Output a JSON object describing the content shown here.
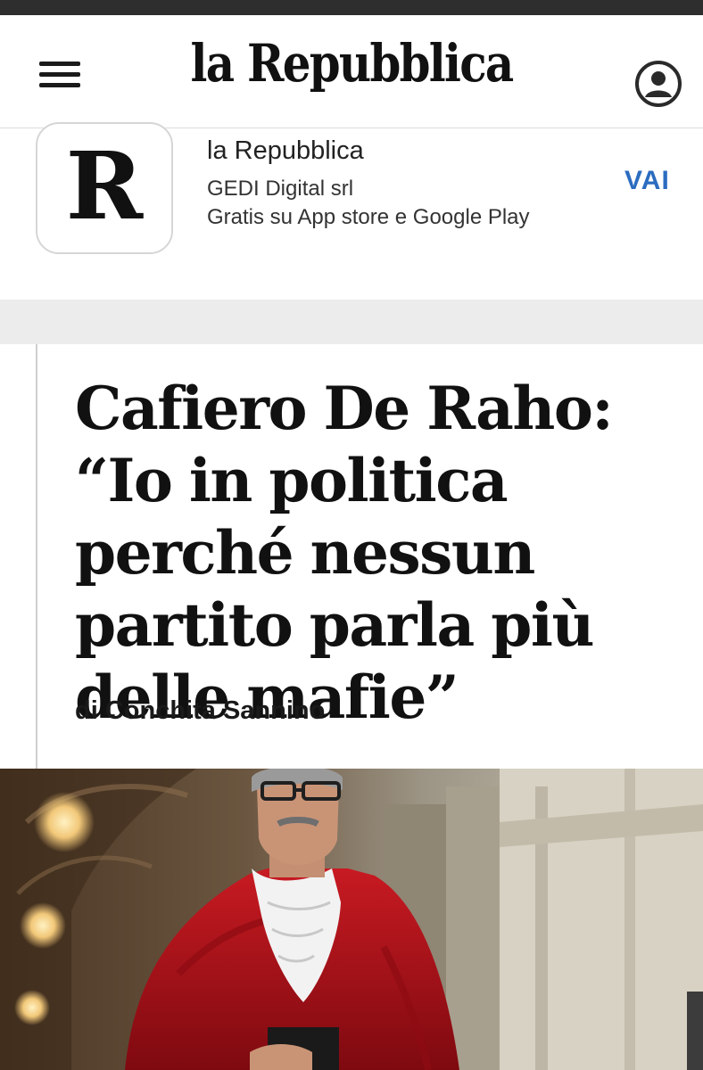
{
  "header": {
    "logo_text": "la Repubblica",
    "menu_icon": "hamburger-menu-icon",
    "account_icon": "user-account-icon"
  },
  "app_banner": {
    "icon_letter": "R",
    "app_name": "la Repubblica",
    "publisher": "GEDI Digital srl",
    "availability": "Gratis su App store e Google Play",
    "cta_label": "VAI",
    "cta_color": "#2b6cc0"
  },
  "article": {
    "headline": "Cafiero De Raho: “Io in politica perché nessun partito parla più delle mafie”",
    "byline": "di Conchita Sannino"
  },
  "colors": {
    "separator": "#ececec",
    "robe_red": "#b5121b",
    "background": "#ffffff"
  }
}
